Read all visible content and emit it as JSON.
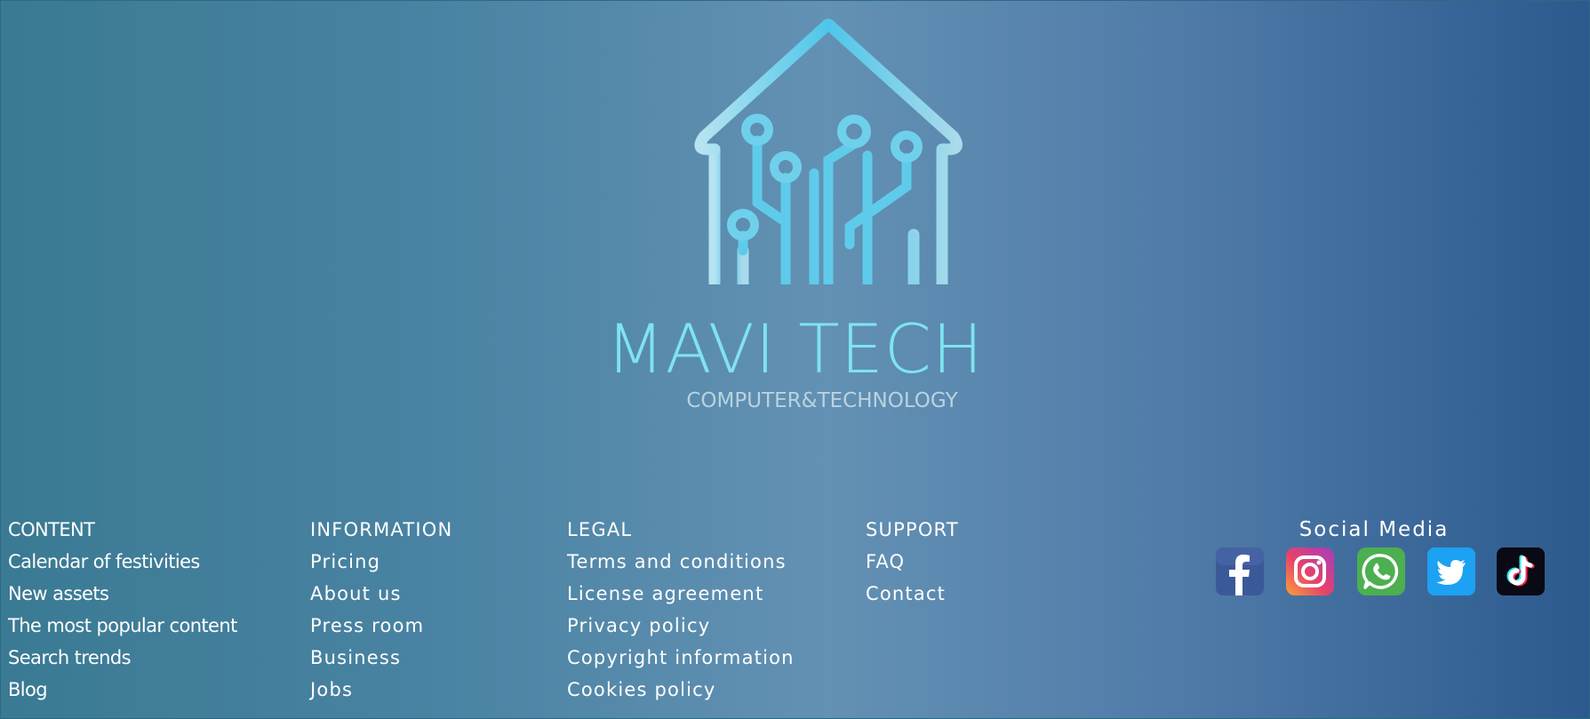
{
  "brand": {
    "name": "MAVI TECH",
    "tagline": "COMPUTER&TECHNOLOGY"
  },
  "columns": [
    {
      "heading": "CONTENT",
      "links": [
        "Calendar of festivities",
        "New assets",
        "The most popular content",
        "Search trends",
        "Blog"
      ]
    },
    {
      "heading": "INFORMATION",
      "links": [
        "Pricing",
        "About us",
        "Press room",
        "Business",
        "Jobs"
      ]
    },
    {
      "heading": "LEGAL",
      "links": [
        "Terms and conditions",
        "License agreement",
        "Privacy policy",
        "Copyright information",
        "Cookies policy"
      ]
    },
    {
      "heading": "SUPPORT",
      "links": [
        "FAQ",
        "Contact"
      ]
    }
  ],
  "social": {
    "title": "Social Media",
    "icons": [
      "facebook-icon",
      "instagram-icon",
      "whatsapp-icon",
      "twitter-icon",
      "tiktok-icon"
    ]
  },
  "colors": {
    "brand": "#7fe3f0",
    "facebook": "#3b5998",
    "whatsapp": "#4caf50",
    "twitter": "#1da1f2",
    "tiktok": "#0a0a14"
  }
}
